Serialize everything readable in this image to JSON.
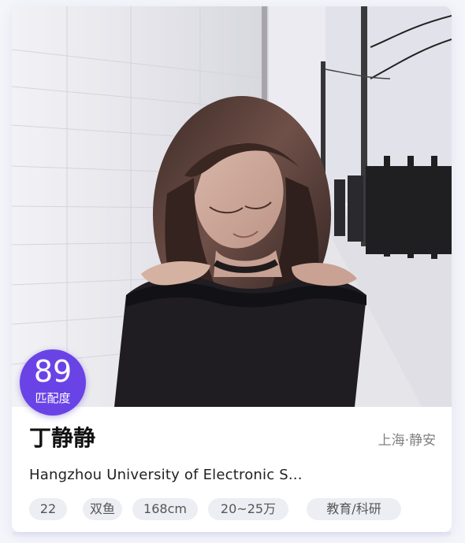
{
  "profile": {
    "match_score": "89",
    "match_label": "匹配度",
    "name": "丁静静",
    "location": "上海·静安",
    "school": "Hangzhou University of Electronic S...",
    "tags": {
      "age": "22",
      "zodiac": "双鱼",
      "height": "168cm",
      "income": "20~25万",
      "industry": "教育/科研"
    }
  },
  "colors": {
    "badge": "#6a43e6",
    "tag_background": "#eceef3",
    "name": "#111111",
    "location": "#808080"
  }
}
